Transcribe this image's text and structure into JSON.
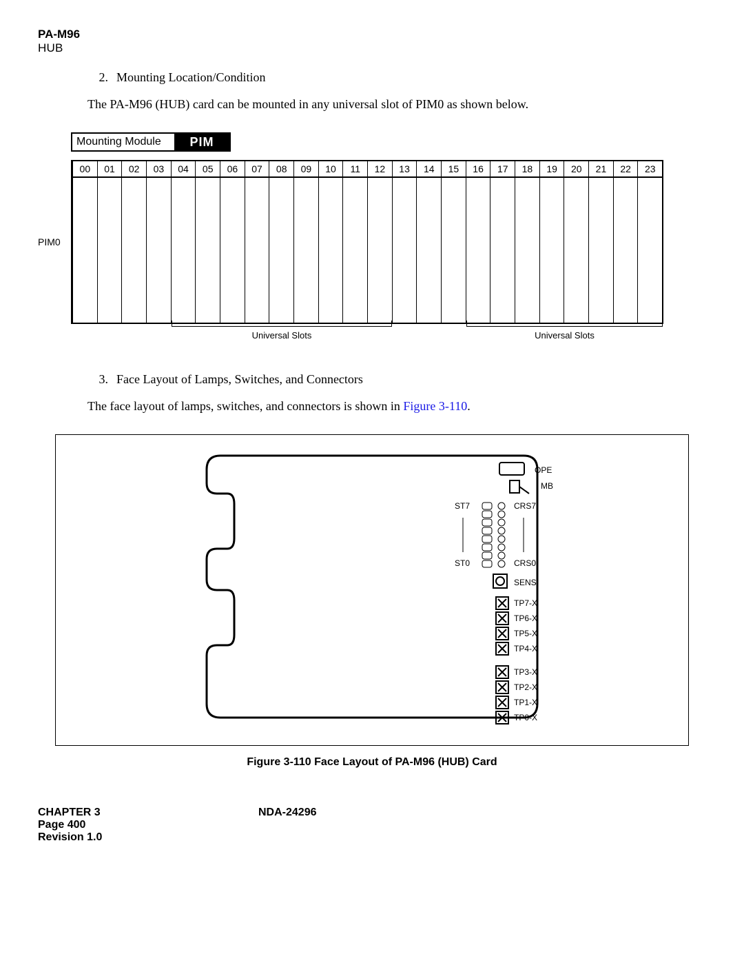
{
  "header": {
    "title": "PA-M96",
    "subtitle": "HUB"
  },
  "sec2": {
    "num": "2.",
    "title": "Mounting Location/Condition",
    "body": "The PA-M96 (HUB) card can be mounted in any universal slot of PIM0 as shown below."
  },
  "mount": {
    "label": "Mounting Module",
    "pim": "PIM",
    "rowlabel": "PIM0",
    "slots": [
      "00",
      "01",
      "02",
      "03",
      "04",
      "05",
      "06",
      "07",
      "08",
      "09",
      "10",
      "11",
      "12",
      "13",
      "14",
      "15",
      "16",
      "17",
      "18",
      "19",
      "20",
      "21",
      "22",
      "23"
    ],
    "uslots_a": "Universal Slots",
    "uslots_b": "Universal Slots"
  },
  "sec3": {
    "num": "3.",
    "title": "Face Layout of Lamps, Switches, and Connectors",
    "body_pre": "The face layout of lamps, switches, and connectors is shown in ",
    "figref": "Figure 3-110",
    "body_post": "."
  },
  "card": {
    "labels": {
      "ope": "OPE",
      "mb": "MB",
      "st7": "ST7",
      "st0": "ST0",
      "crs7": "CRS7",
      "crs0": "CRS0",
      "sens": "SENS",
      "tp7": "TP7-X",
      "tp6": "TP6-X",
      "tp5": "TP5-X",
      "tp4": "TP4-X",
      "tp3": "TP3-X",
      "tp2": "TP2-X",
      "tp1": "TP1-X",
      "tp0": "TP0-X"
    }
  },
  "figcaption": "Figure 3-110   Face Layout of PA-M96 (HUB) Card",
  "footer": {
    "chapter": "CHAPTER 3",
    "doc": "NDA-24296",
    "page": "Page 400",
    "rev": "Revision 1.0"
  }
}
